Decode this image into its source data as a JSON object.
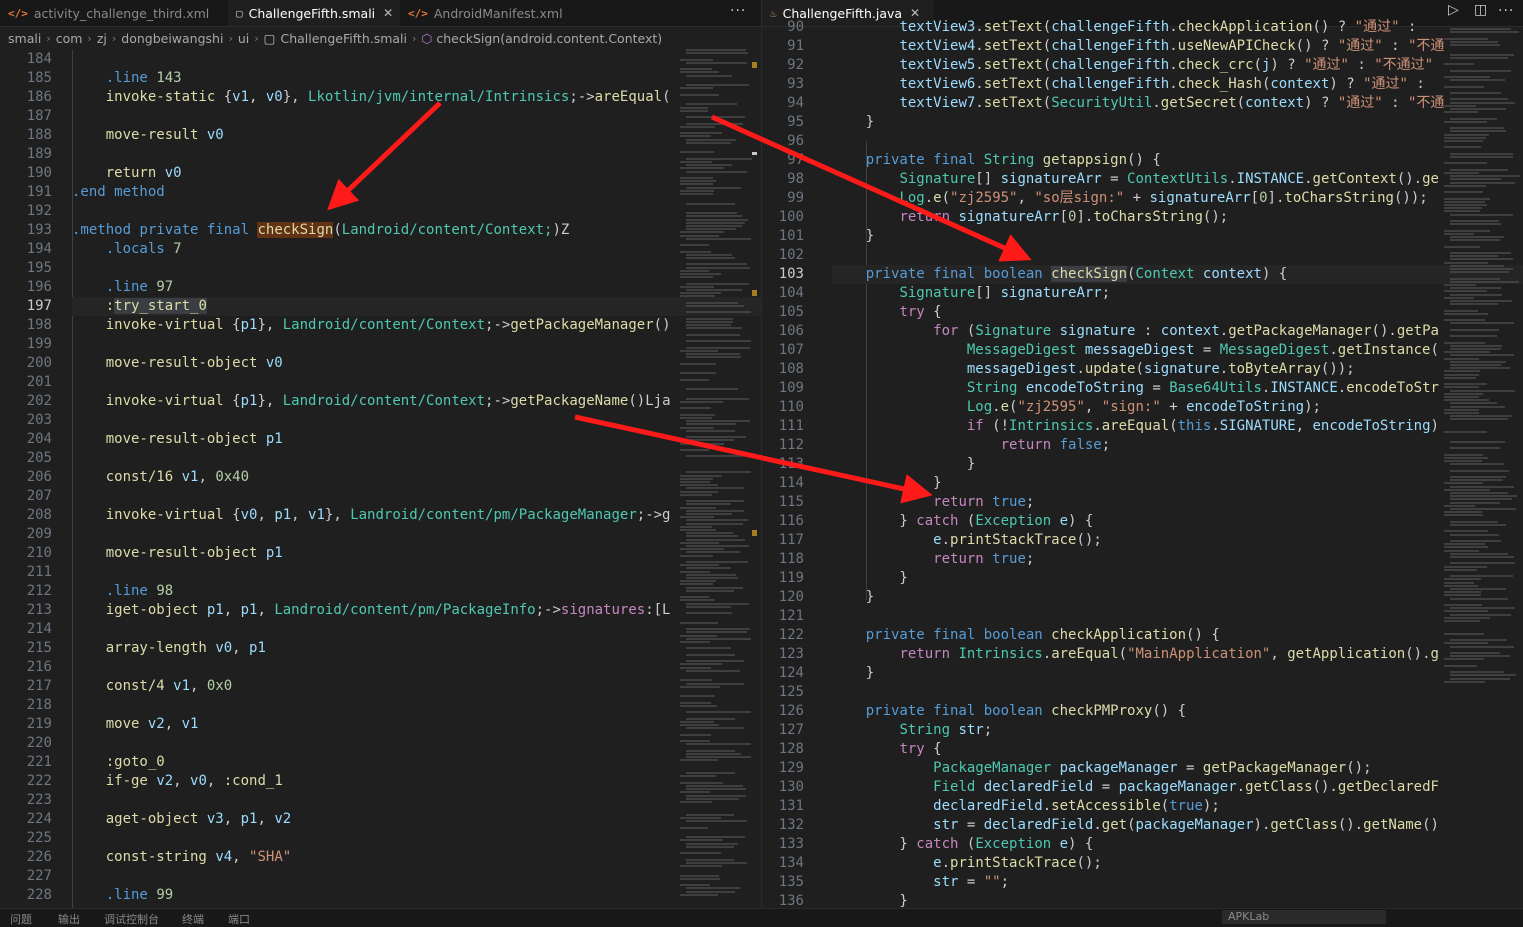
{
  "left": {
    "tabs": [
      {
        "label": "activity_challenge_third.xml",
        "icon": "xml-icon",
        "active": false
      },
      {
        "label": "ChallengeFifth.smali",
        "icon": "file-icon",
        "active": true
      },
      {
        "label": "AndroidManifest.xml",
        "icon": "xml-icon",
        "active": false
      }
    ],
    "more": "···",
    "breadcrumb": [
      "smali",
      "com",
      "zj",
      "dongbeiwangshi",
      "ui",
      "ChallengeFifth.smali",
      "checkSign(android.content.Context)"
    ],
    "line_numbers": [
      "184",
      "185",
      "186",
      "187",
      "188",
      "189",
      "190",
      "191",
      "192",
      "193",
      "194",
      "195",
      "196",
      "197",
      "198",
      "199",
      "200",
      "201",
      "202",
      "203",
      "204",
      "205",
      "206",
      "207",
      "208",
      "209",
      "210",
      "211",
      "212",
      "213",
      "214",
      "215",
      "216",
      "217",
      "218",
      "219",
      "220",
      "221",
      "222",
      "223",
      "224",
      "225",
      "226",
      "227",
      "228"
    ],
    "current_line": "197"
  },
  "right": {
    "tabs": [
      {
        "label": "ChallengeFifth.java",
        "icon": "java-icon",
        "active": true
      }
    ],
    "more": "···",
    "line_numbers": [
      "90",
      "91",
      "92",
      "93",
      "94",
      "95",
      "96",
      "97",
      "98",
      "99",
      "100",
      "101",
      "102",
      "103",
      "104",
      "105",
      "106",
      "107",
      "108",
      "109",
      "110",
      "111",
      "112",
      "113",
      "114",
      "115",
      "116",
      "117",
      "118",
      "119",
      "120",
      "121",
      "122",
      "123",
      "124",
      "125",
      "126",
      "127",
      "128",
      "129",
      "130",
      "131",
      "132",
      "133",
      "134",
      "135",
      "136"
    ],
    "current_line": "103"
  },
  "status": {
    "items": [
      "问题",
      "输出",
      "调试控制台",
      "终端",
      "端口"
    ],
    "right": "APKLab"
  },
  "colors": {
    "arrow": "#ff1a1a",
    "highlight": "#613214",
    "background": "#1f1f1f"
  }
}
